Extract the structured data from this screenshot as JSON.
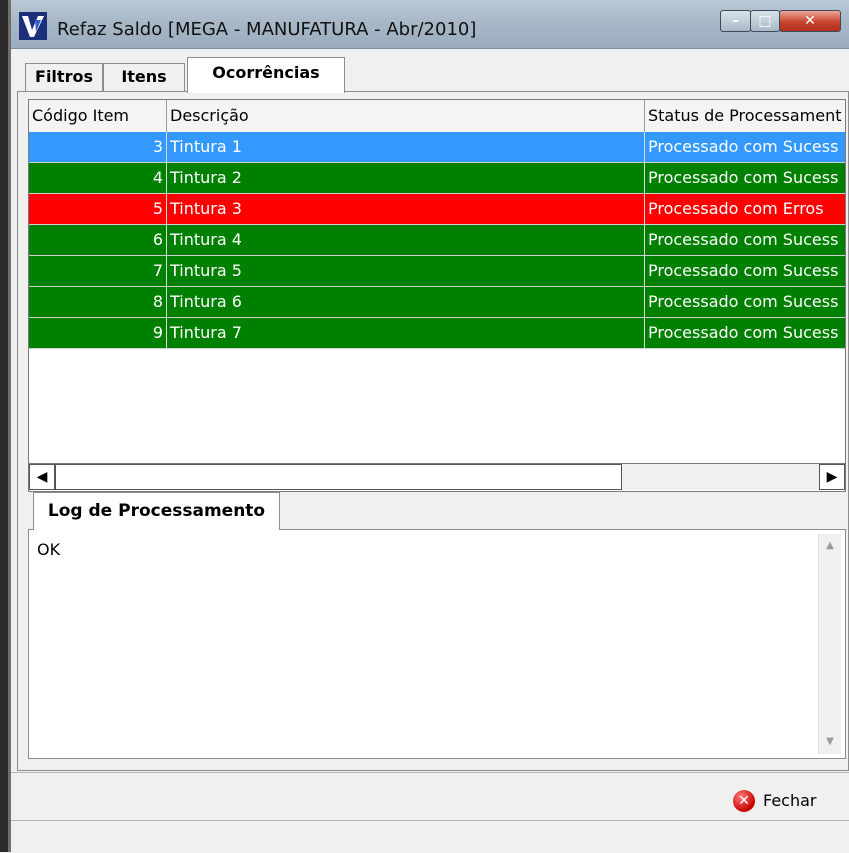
{
  "window": {
    "title": "Refaz Saldo [MEGA - MANUFATURA - Abr/2010]"
  },
  "tabs": [
    "Filtros",
    "Itens",
    "Ocorrências"
  ],
  "grid": {
    "columns": [
      "Código Item",
      "Descrição",
      "Status de Processament"
    ],
    "rows": [
      {
        "code": "3",
        "desc": "Tintura 1",
        "status": "Processado com Sucess",
        "color": "#3399ff"
      },
      {
        "code": "4",
        "desc": "Tintura 2",
        "status": "Processado com Sucess",
        "color": "#008000"
      },
      {
        "code": "5",
        "desc": "Tintura 3",
        "status": "Processado com Erros",
        "color": "#ff0000"
      },
      {
        "code": "6",
        "desc": "Tintura 4",
        "status": "Processado com Sucess",
        "color": "#008000"
      },
      {
        "code": "7",
        "desc": "Tintura 5",
        "status": "Processado com Sucess",
        "color": "#008000"
      },
      {
        "code": "8",
        "desc": "Tintura 6",
        "status": "Processado com Sucess",
        "color": "#008000"
      },
      {
        "code": "9",
        "desc": "Tintura 7",
        "status": "Processado com Sucess",
        "color": "#008000"
      }
    ]
  },
  "log": {
    "tab": "Log de Processamento",
    "text": "OK"
  },
  "footer": {
    "close_label": "Fechar"
  }
}
